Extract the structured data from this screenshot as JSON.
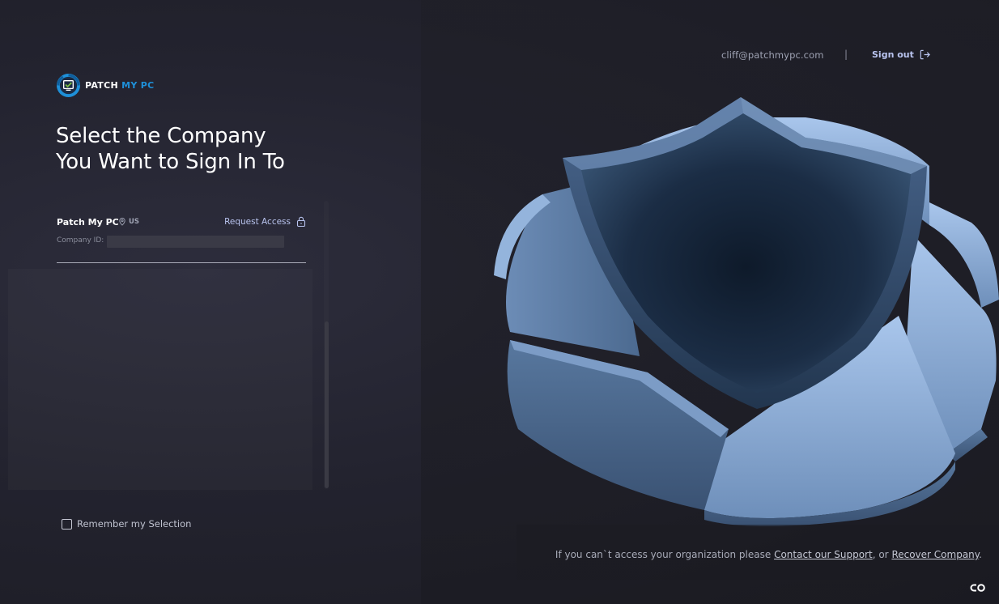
{
  "header": {
    "user_email": "cliff@patchmypc.com",
    "separator": "|",
    "sign_out_label": "Sign out"
  },
  "brand": {
    "name_part1": "PATCH",
    "name_part2": "MY PC",
    "brand_color": "#1e90d9"
  },
  "heading": {
    "line1": "Select the Company",
    "line2": "You Want to Sign In To"
  },
  "companies": [
    {
      "name": "Patch My PC",
      "region": "US",
      "request_access_label": "Request Access",
      "company_id_label": "Company ID:",
      "company_id_value": ""
    }
  ],
  "remember": {
    "label": "Remember my Selection",
    "checked": false
  },
  "footer": {
    "prefix": "If you can`t access your organization please",
    "support_link": "Contact our Support",
    "middle": ", or",
    "recover_link": "Recover Company",
    "suffix": "."
  },
  "icons": {
    "sign_out": "sign-out-icon",
    "location": "location-pin-icon",
    "lock": "lock-icon",
    "assist": "assist-widget-icon"
  },
  "colors": {
    "accent_link": "#b9c4ef",
    "background": "#23232f",
    "illustration_blue": "#6f93c2",
    "shield_dark": "#162538"
  }
}
